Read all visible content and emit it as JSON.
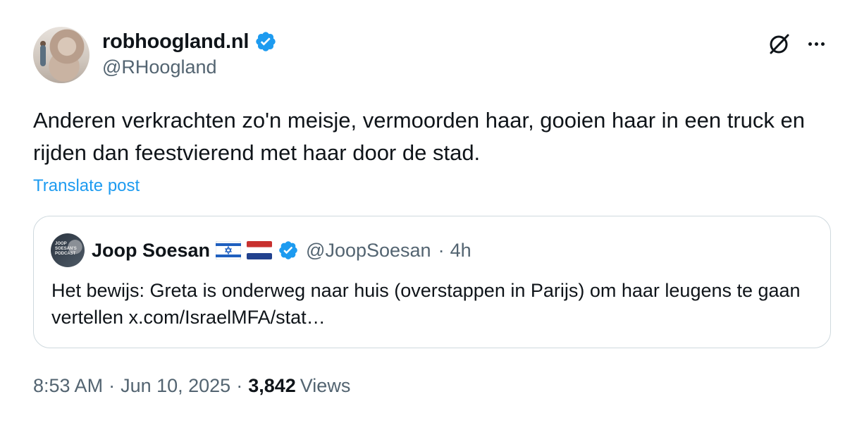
{
  "author": {
    "display_name": "robhoogland.nl",
    "handle": "@RHoogland",
    "verified": true,
    "avatar_icon": "profile-photo"
  },
  "post": {
    "text": "Anderen verkrachten zo'n meisje, vermoorden haar, gooien haar in een truck en rijden dan feestvierend met haar door de stad.",
    "translate_label": "Translate post"
  },
  "quoted": {
    "display_name": "Joop Soesan",
    "flags": [
      "israel-flag-icon",
      "netherlands-flag-icon"
    ],
    "handle": "@JoopSoesan",
    "separator": "·",
    "time": "4h",
    "text": "Het bewijs: Greta is onderweg naar huis (overstappen in Parijs) om haar leugens te gaan vertellen x.com/IsraelMFA/stat…",
    "avatar_text": "JOOP SOESAN'S PODCAST"
  },
  "meta": {
    "time": "8:53 AM",
    "sep1": "·",
    "date": "Jun 10, 2025",
    "sep2": "·",
    "views_count": "3,842",
    "views_label": "Views"
  },
  "colors": {
    "accent": "#1d9bf0",
    "secondary_text": "#536471",
    "border": "#cfd9de",
    "primary_text": "#0f1419"
  }
}
